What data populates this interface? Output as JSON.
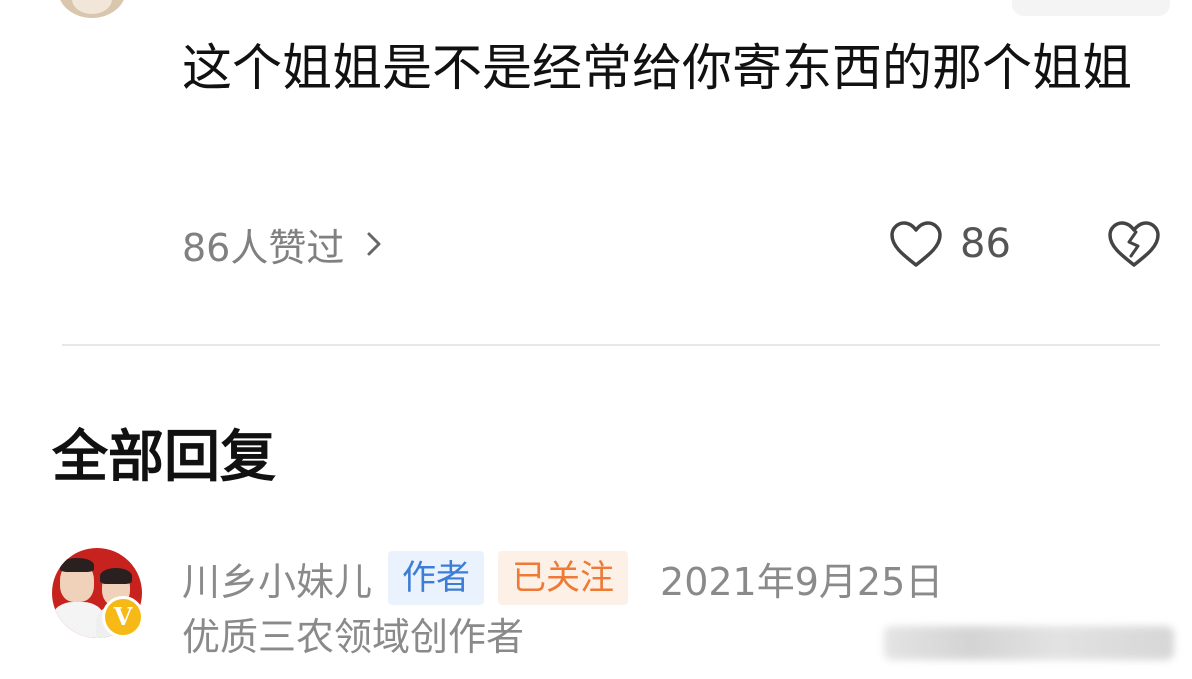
{
  "comment": {
    "text": "这个姐姐是不是经常给你寄东西的那个姐姐",
    "likes_link": "86人赞过",
    "like_count": "86"
  },
  "icons": {
    "like": "heart-outline-icon",
    "dislike": "broken-heart-icon",
    "more": "chevron-right-icon",
    "verified": "v-badge-icon"
  },
  "replies_section": {
    "title": "全部回复"
  },
  "reply": {
    "username": "川乡小妹儿",
    "tag_author": "作者",
    "tag_follow": "已关注",
    "date": "2021年9月25日",
    "description": "优质三农领域创作者",
    "badge": "V"
  },
  "colors": {
    "text_primary": "#111111",
    "text_secondary": "#8a8a8a",
    "author_tag_bg": "#eaf2fd",
    "author_tag_text": "#3e7dd6",
    "follow_tag_bg": "#fdf0e6",
    "follow_tag_text": "#ee7a35",
    "badge": "#f6b915"
  }
}
